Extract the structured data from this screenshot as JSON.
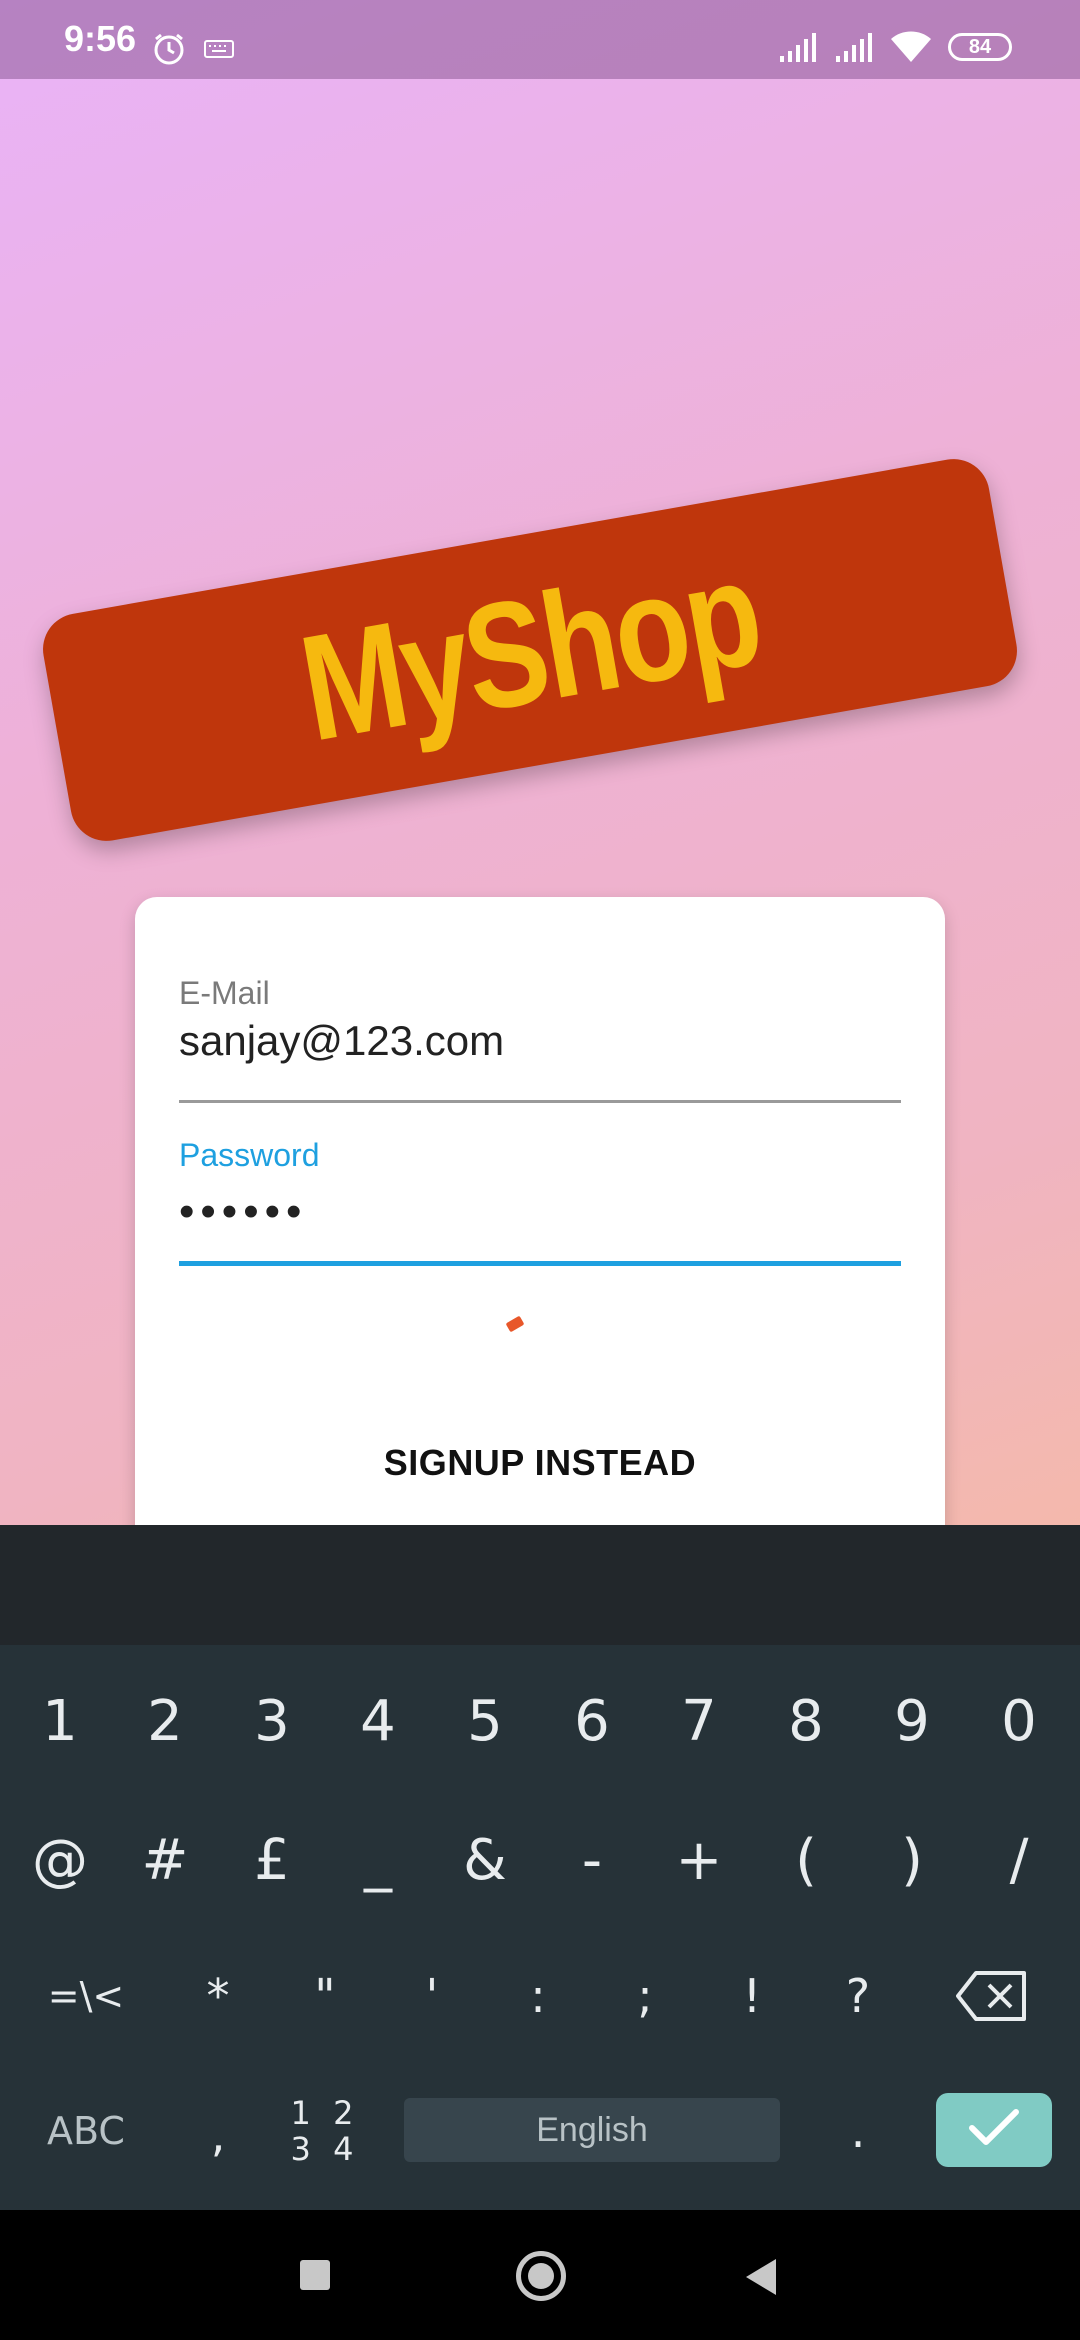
{
  "status_bar": {
    "time": "9:56",
    "battery": "84"
  },
  "app": {
    "logo_text": "MyShop"
  },
  "auth_form": {
    "email_label": "E-Mail",
    "email_value": "sanjay@123.com",
    "password_label": "Password",
    "password_value": "••••••",
    "switch_button": "SIGNUP INSTEAD"
  },
  "keyboard": {
    "row1": [
      "1",
      "2",
      "3",
      "4",
      "5",
      "6",
      "7",
      "8",
      "9",
      "0"
    ],
    "row2": [
      "@",
      "#",
      "£",
      "_",
      "&",
      "-",
      "+",
      "(",
      ")",
      "/"
    ],
    "row3": [
      "=\\<",
      "*",
      "\"",
      "'",
      ":",
      ";",
      "!",
      "?"
    ],
    "abc_label": "ABC",
    "comma": ",",
    "num_top": "1 2",
    "num_bottom": "3 4",
    "space_label": "English",
    "period": "."
  },
  "colors": {
    "banner": "#bf360c",
    "logo_text": "#f6b90f",
    "focus_accent": "#1ea0e0",
    "enter_key": "#80cbc4"
  }
}
